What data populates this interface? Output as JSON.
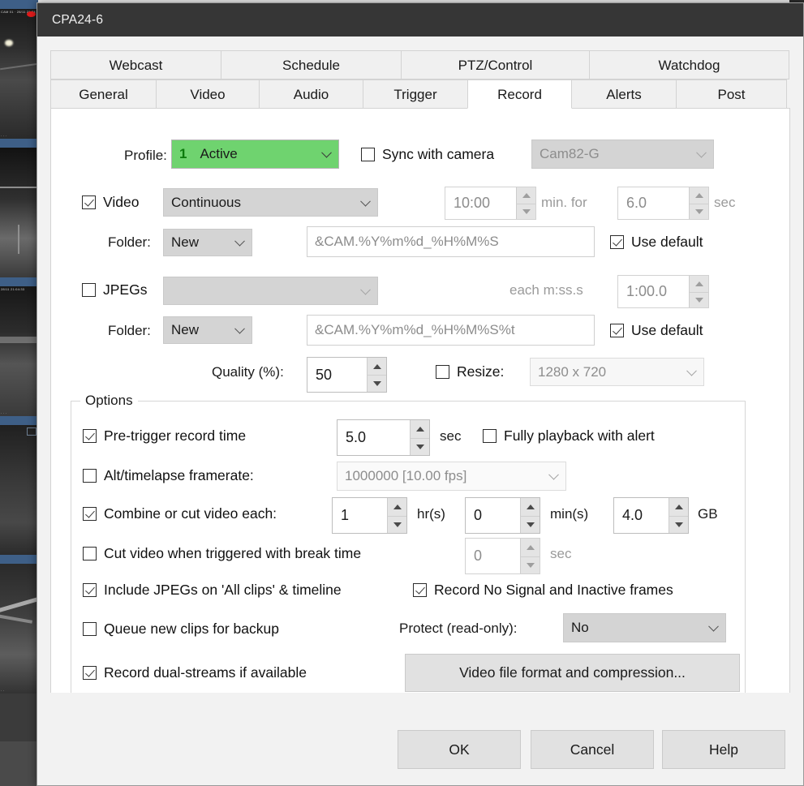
{
  "window": {
    "title": "CPA24-6"
  },
  "tabs": {
    "row1": [
      {
        "label": "Webcast",
        "active": false
      },
      {
        "label": "Schedule",
        "active": false
      },
      {
        "label": "PTZ/Control",
        "active": false
      },
      {
        "label": "Watchdog",
        "active": false
      }
    ],
    "row2": [
      {
        "label": "General",
        "active": false
      },
      {
        "label": "Video",
        "active": false
      },
      {
        "label": "Audio",
        "active": false
      },
      {
        "label": "Trigger",
        "active": false
      },
      {
        "label": "Record",
        "active": true
      },
      {
        "label": "Alerts",
        "active": false
      },
      {
        "label": "Post",
        "active": false
      }
    ]
  },
  "record": {
    "profile_label": "Profile:",
    "profile_number": "1",
    "profile_value": "Active",
    "sync_with_camera_label": "Sync with camera",
    "sync_with_camera_checked": false,
    "camera_value": "Cam82-G",
    "video_label": "Video",
    "video_checked": true,
    "video_mode": "Continuous",
    "video_every": "10:00",
    "video_min_for_label": "min. for",
    "video_duration": "6.0",
    "video_sec_label": "sec",
    "video_folder_label": "Folder:",
    "video_folder_mode": "New",
    "video_folder_path": "&CAM.%Y%m%d_%H%M%S",
    "video_use_default_label": "Use default",
    "video_use_default_checked": true,
    "jpegs_label": "JPEGs",
    "jpegs_checked": false,
    "jpegs_mode": "",
    "jpegs_each_label": "each m:ss.s",
    "jpegs_interval": "1:00.0",
    "jpegs_folder_label": "Folder:",
    "jpegs_folder_mode": "New",
    "jpegs_folder_path": "&CAM.%Y%m%d_%H%M%S%t",
    "jpegs_use_default_label": "Use default",
    "jpegs_use_default_checked": true,
    "quality_label": "Quality (%):",
    "quality_value": "50",
    "resize_label": "Resize:",
    "resize_checked": false,
    "resize_value": "1280 x 720"
  },
  "options": {
    "title": "Options",
    "pretrigger_label": "Pre-trigger record time",
    "pretrigger_checked": true,
    "pretrigger_value": "5.0",
    "pretrigger_unit": "sec",
    "fully_playback_label": "Fully playback with alert",
    "fully_playback_checked": false,
    "alt_framerate_label": "Alt/timelapse framerate:",
    "alt_framerate_checked": false,
    "alt_framerate_value": "1000000 [10.00 fps]",
    "combine_label": "Combine or cut video each:",
    "combine_checked": true,
    "combine_hours": "1",
    "combine_hours_unit": "hr(s)",
    "combine_mins": "0",
    "combine_mins_unit": "min(s)",
    "combine_size": "4.0",
    "combine_size_unit": "GB",
    "cut_on_trigger_label": "Cut video when triggered with break time",
    "cut_on_trigger_checked": false,
    "cut_on_trigger_value": "0",
    "cut_on_trigger_unit": "sec",
    "include_jpegs_label": "Include JPEGs on 'All clips' & timeline",
    "include_jpegs_checked": true,
    "record_no_signal_label": "Record No Signal and Inactive frames",
    "record_no_signal_checked": true,
    "queue_backup_label": "Queue new clips for backup",
    "queue_backup_checked": false,
    "protect_label": "Protect (read-only):",
    "protect_value": "No",
    "dual_streams_label": "Record dual-streams if available",
    "dual_streams_checked": true,
    "video_format_button": "Video file format and compression..."
  },
  "footer": {
    "ok": "OK",
    "cancel": "Cancel",
    "help": "Help"
  },
  "colors": {
    "profile_green": "#6fd36f",
    "titlebar": "#363636",
    "rec_dot": "#e21b1b"
  }
}
